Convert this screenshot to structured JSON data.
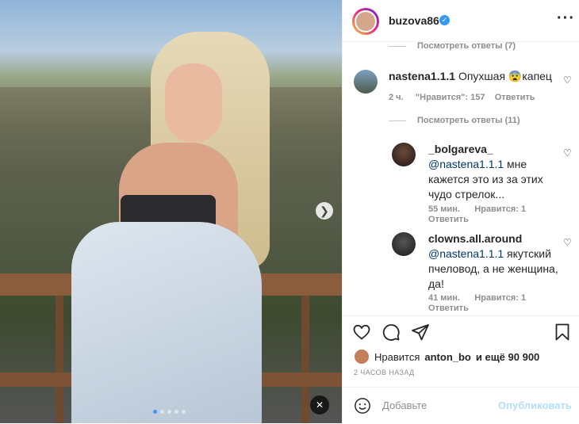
{
  "post": {
    "username": "buzova86",
    "carousel_dots": 5,
    "active_dot": 1
  },
  "comments": {
    "view_replies_top": "Посмотреть ответы (7)",
    "main": {
      "username": "nastena1.1.1",
      "text": "Опухшая 😨капец",
      "time": "2 ч.",
      "likes": "\"Нравится\": 157",
      "reply": "Ответить"
    },
    "view_replies_main": "Посмотреть ответы (11)",
    "replies": [
      {
        "username": "_bolgareva_",
        "mention": "@nastena1.1.1",
        "text_line1": " мне",
        "text_line2": "кажется это из за этих",
        "text_line3": "чудо стрелок...",
        "time": "55 мин.",
        "likes": "Нравится: 1",
        "reply": "Ответить"
      },
      {
        "username": "clowns.all.around",
        "mention": "@nastena1.1.1",
        "text_line1": " якутский",
        "text_line2": "пчеловод, а не женщина,",
        "text_line3": "да!",
        "time": "41 мин.",
        "likes": "Нравится: 1",
        "reply": "Ответить"
      }
    ]
  },
  "likes_row": {
    "prefix": "Нравится",
    "user": "anton_bo",
    "suffix": "и ещё 90 900"
  },
  "timestamp": "2 ЧАСОВ НАЗАД",
  "add_comment": {
    "placeholder": "Добавьте",
    "publish": "Опубликовать"
  },
  "colors": {
    "link": "#00376b",
    "publish_disabled": "#b2dffc",
    "verified": "#3897f0"
  },
  "icons": [
    "heart-icon",
    "comment-icon",
    "share-icon",
    "bookmark-icon",
    "verified-icon",
    "more-icon",
    "smile-icon",
    "mute-icon",
    "next-arrow-icon"
  ]
}
